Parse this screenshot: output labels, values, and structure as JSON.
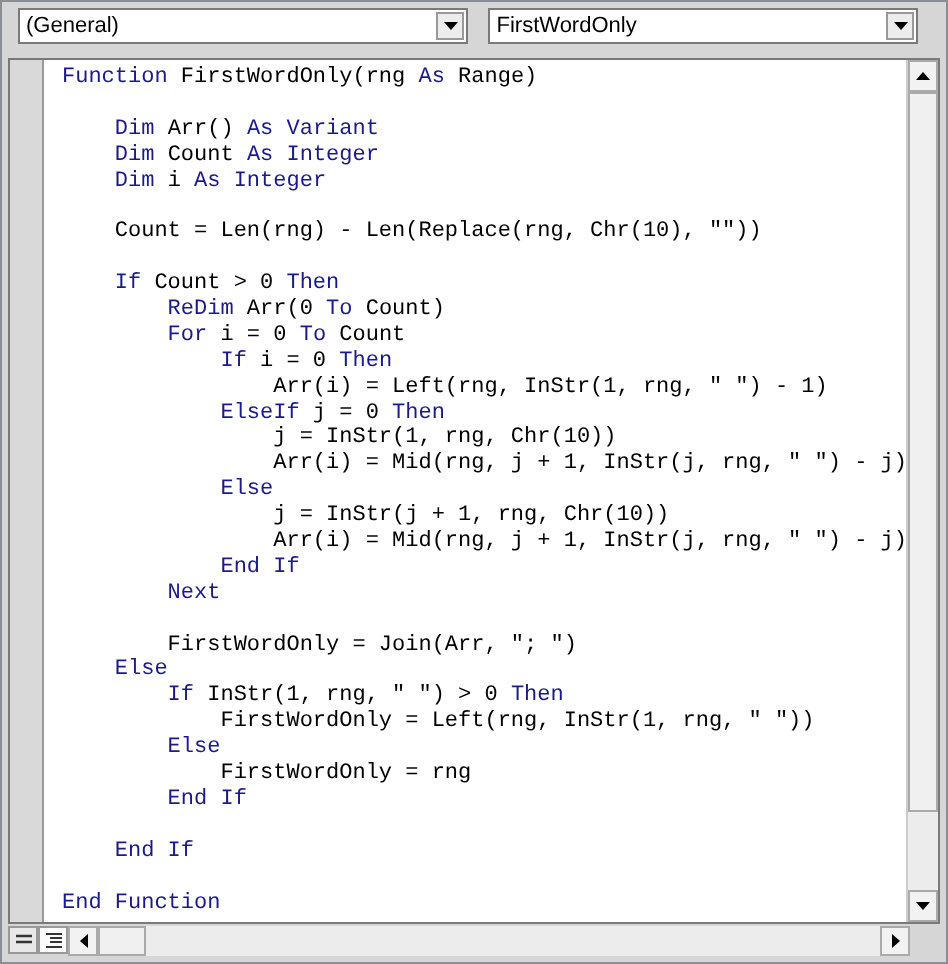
{
  "dropdowns": [
    {
      "value": "(General)"
    },
    {
      "value": "FirstWordOnly"
    }
  ],
  "code_lines": [
    {
      "kind": "code",
      "tokens": [
        {
          "kind": "keyword",
          "text": "Function"
        },
        {
          "kind": "plain",
          "text": " FirstWordOnly(rng "
        },
        {
          "kind": "keyword",
          "text": "As"
        },
        {
          "kind": "plain",
          "text": " Range)"
        }
      ]
    },
    {
      "kind": "blank"
    },
    {
      "kind": "code",
      "tokens": [
        {
          "kind": "keyword",
          "text": "    Dim"
        },
        {
          "kind": "plain",
          "text": " Arr() "
        },
        {
          "kind": "keyword",
          "text": "As Variant"
        }
      ]
    },
    {
      "kind": "code",
      "tokens": [
        {
          "kind": "keyword",
          "text": "    Dim"
        },
        {
          "kind": "plain",
          "text": " Count "
        },
        {
          "kind": "keyword",
          "text": "As Integer"
        }
      ]
    },
    {
      "kind": "code",
      "tokens": [
        {
          "kind": "keyword",
          "text": "    Dim"
        },
        {
          "kind": "plain",
          "text": " i "
        },
        {
          "kind": "keyword",
          "text": "As Integer"
        }
      ]
    },
    {
      "kind": "blank"
    },
    {
      "kind": "code",
      "tokens": [
        {
          "kind": "plain",
          "text": "    Count = Len(rng) - Len(Replace(rng, Chr(10), \"\"))"
        }
      ]
    },
    {
      "kind": "blank"
    },
    {
      "kind": "code",
      "tokens": [
        {
          "kind": "keyword",
          "text": "    If"
        },
        {
          "kind": "plain",
          "text": " Count > 0 "
        },
        {
          "kind": "keyword",
          "text": "Then"
        }
      ]
    },
    {
      "kind": "code",
      "tokens": [
        {
          "kind": "keyword",
          "text": "        ReDim"
        },
        {
          "kind": "plain",
          "text": " Arr(0 "
        },
        {
          "kind": "keyword",
          "text": "To"
        },
        {
          "kind": "plain",
          "text": " Count)"
        }
      ]
    },
    {
      "kind": "code",
      "tokens": [
        {
          "kind": "keyword",
          "text": "        For"
        },
        {
          "kind": "plain",
          "text": " i = 0 "
        },
        {
          "kind": "keyword",
          "text": "To"
        },
        {
          "kind": "plain",
          "text": " Count"
        }
      ]
    },
    {
      "kind": "code",
      "tokens": [
        {
          "kind": "keyword",
          "text": "            If"
        },
        {
          "kind": "plain",
          "text": " i = 0 "
        },
        {
          "kind": "keyword",
          "text": "Then"
        }
      ]
    },
    {
      "kind": "code",
      "tokens": [
        {
          "kind": "plain",
          "text": "                Arr(i) = Left(rng, InStr(1, rng, \" \") - 1)"
        }
      ]
    },
    {
      "kind": "code",
      "tokens": [
        {
          "kind": "keyword",
          "text": "            ElseIf"
        },
        {
          "kind": "plain",
          "text": " j = 0 "
        },
        {
          "kind": "keyword",
          "text": "Then"
        }
      ]
    },
    {
      "kind": "code",
      "tokens": [
        {
          "kind": "plain",
          "text": "                j = InStr(1, rng, Chr(10))"
        }
      ]
    },
    {
      "kind": "code",
      "tokens": [
        {
          "kind": "plain",
          "text": "                Arr(i) = Mid(rng, j + 1, InStr(j, rng, \" \") - j)"
        }
      ]
    },
    {
      "kind": "code",
      "tokens": [
        {
          "kind": "keyword",
          "text": "            Else"
        }
      ]
    },
    {
      "kind": "code",
      "tokens": [
        {
          "kind": "plain",
          "text": "                j = InStr(j + 1, rng, Chr(10))"
        }
      ]
    },
    {
      "kind": "code",
      "tokens": [
        {
          "kind": "plain",
          "text": "                Arr(i) = Mid(rng, j + 1, InStr(j, rng, \" \") - j)"
        }
      ]
    },
    {
      "kind": "code",
      "tokens": [
        {
          "kind": "keyword",
          "text": "            End If"
        }
      ]
    },
    {
      "kind": "code",
      "tokens": [
        {
          "kind": "keyword",
          "text": "        Next"
        }
      ]
    },
    {
      "kind": "blank"
    },
    {
      "kind": "code",
      "tokens": [
        {
          "kind": "plain",
          "text": "        FirstWordOnly = Join(Arr, \"; \")"
        }
      ]
    },
    {
      "kind": "code",
      "tokens": [
        {
          "kind": "keyword",
          "text": "    Else"
        }
      ]
    },
    {
      "kind": "code",
      "tokens": [
        {
          "kind": "keyword",
          "text": "        If"
        },
        {
          "kind": "plain",
          "text": " InStr(1, rng, \" \") > 0 "
        },
        {
          "kind": "keyword",
          "text": "Then"
        }
      ]
    },
    {
      "kind": "code",
      "tokens": [
        {
          "kind": "plain",
          "text": "            FirstWordOnly = Left(rng, InStr(1, rng, \" \"))"
        }
      ]
    },
    {
      "kind": "code",
      "tokens": [
        {
          "kind": "keyword",
          "text": "        Else"
        }
      ]
    },
    {
      "kind": "code",
      "tokens": [
        {
          "kind": "plain",
          "text": "            FirstWordOnly = rng"
        }
      ]
    },
    {
      "kind": "code",
      "tokens": [
        {
          "kind": "keyword",
          "text": "        End If"
        }
      ]
    },
    {
      "kind": "blank"
    },
    {
      "kind": "code",
      "tokens": [
        {
          "kind": "keyword",
          "text": "    End If"
        }
      ]
    },
    {
      "kind": "blank"
    },
    {
      "kind": "code",
      "tokens": [
        {
          "kind": "keyword",
          "text": "End Function"
        }
      ]
    }
  ]
}
